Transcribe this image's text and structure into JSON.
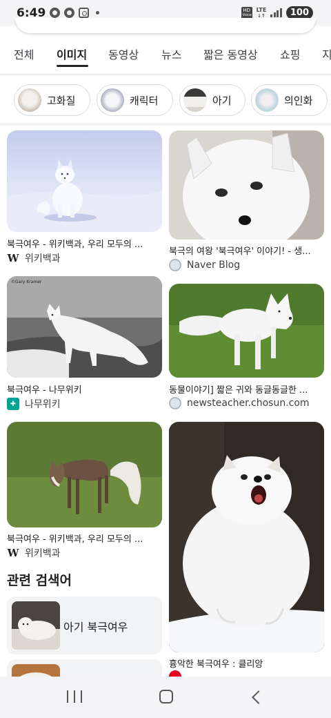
{
  "status_bar": {
    "time": "6:49",
    "hd_label": "HD",
    "voice_label": "Voice",
    "network": "LTE",
    "battery": "100"
  },
  "tabs": [
    {
      "label": "전체"
    },
    {
      "label": "이미지",
      "active": true
    },
    {
      "label": "동영상"
    },
    {
      "label": "뉴스"
    },
    {
      "label": "짧은 동영상"
    },
    {
      "label": "쇼핑"
    },
    {
      "label": "지"
    }
  ],
  "chips": [
    {
      "label": "고화질"
    },
    {
      "label": "캐릭터"
    },
    {
      "label": "아기"
    },
    {
      "label": "의인화"
    }
  ],
  "results": [
    {
      "title": "북극여우 - 위키백과, 우리 모두의 ...",
      "source": "위키백과",
      "source_icon": "wikipedia-icon"
    },
    {
      "title": "북극의 여왕 '북극여우' 이야기! - 생...",
      "source": "Naver Blog",
      "source_icon": "globe-icon"
    },
    {
      "title": "북극여우 - 나무위키",
      "source": "나무위키",
      "source_icon": "namuwiki-icon"
    },
    {
      "title": "동물이야기] 짧은 귀와 동글동글한 ...",
      "source": "newsteacher.chosun.com",
      "source_icon": "globe-icon"
    },
    {
      "title": "북극여우 - 위키백과, 우리 모두의 ...",
      "source": "위키백과",
      "source_icon": "wikipedia-icon"
    },
    {
      "title": "흉악한 북극여우 : 클리앙",
      "source": "",
      "source_icon": "pinterest-icon"
    }
  ],
  "photo_credit": "©Gary Kramer",
  "related": {
    "heading": "관련 검색어",
    "items": [
      {
        "label": "아기 북극여우"
      }
    ]
  },
  "colors": {
    "accent_text": "#202124",
    "chip_border": "#dadce0",
    "related_bg": "#f1f3f4",
    "namu_green": "#00a495"
  }
}
